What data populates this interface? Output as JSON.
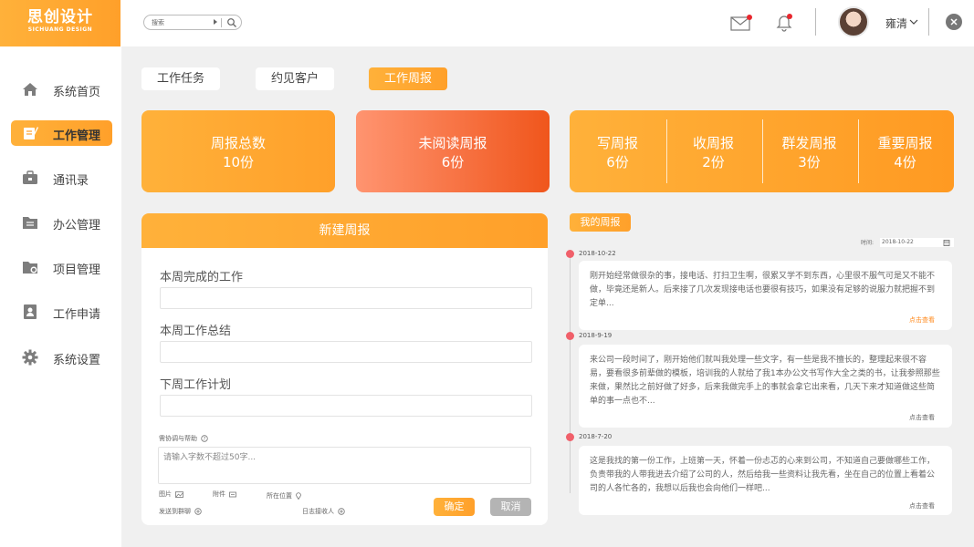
{
  "brand": {
    "name": "思创设计",
    "sub": "SICHUANG DESIGN",
    "accent": "#ffa02a",
    "alert": "#f0606a"
  },
  "search": {
    "placeholder": "搜索"
  },
  "user": {
    "name": "雍清"
  },
  "sidebar": {
    "items": [
      {
        "label": "系统首页",
        "icon": "home-icon",
        "active": false
      },
      {
        "label": "工作管理",
        "icon": "edit-note-icon",
        "active": true
      },
      {
        "label": "通讯录",
        "icon": "briefcase-icon",
        "active": false
      },
      {
        "label": "办公管理",
        "icon": "folder-doc-icon",
        "active": false
      },
      {
        "label": "项目管理",
        "icon": "folder-gear-icon",
        "active": false
      },
      {
        "label": "工作申请",
        "icon": "id-card-icon",
        "active": false
      },
      {
        "label": "系统设置",
        "icon": "gear-icon",
        "active": false
      }
    ]
  },
  "tabs": [
    {
      "label": "工作任务",
      "active": false
    },
    {
      "label": "约见客户",
      "active": false
    },
    {
      "label": "工作周报",
      "active": true
    }
  ],
  "stats": {
    "total": {
      "title": "周报总数",
      "value": "10份"
    },
    "unread": {
      "title": "未阅读周报",
      "value": "6份"
    },
    "group": [
      {
        "title": "写周报",
        "value": "6份"
      },
      {
        "title": "收周报",
        "value": "2份"
      },
      {
        "title": "群发周报",
        "value": "3份"
      },
      {
        "title": "重要周报",
        "value": "4份"
      }
    ]
  },
  "form": {
    "title": "新建周报",
    "fields": [
      {
        "label": "本周完成的工作",
        "value": ""
      },
      {
        "label": "本周工作总结",
        "value": ""
      },
      {
        "label": "下周工作计划",
        "value": ""
      }
    ],
    "help_label": "需协调与帮助",
    "help_placeholder": "请输入字数不超过50字...",
    "attach": {
      "image": "图片",
      "file": "附件",
      "location": "所在位置",
      "send_group": "发送到群聊",
      "receivers": "日志接收人"
    },
    "ok_label": "确定",
    "cancel_label": "取消"
  },
  "reports": {
    "title": "我的周报",
    "time_label": "时间:",
    "time_value": "2018-10-22",
    "items": [
      {
        "date": "2018-10-22",
        "text": "刚开始经常做很杂的事，接电话、打扫卫生啊，很累又学不到东西，心里很不服气可是又不能不做，毕竟还是新人。后来接了几次发现接电话也要很有技巧，如果没有足够的说服力就把握不到定单...",
        "link": "点击查看",
        "link_color": "#ff8a1e"
      },
      {
        "date": "2018-9-19",
        "text": "来公司一段时间了，刚开始他们就叫我处理一些文字，有一些是我不擅长的，整理起来很不容易，要看很多前辈做的模板，培训我的人就给了我1本办公文书写作大全之类的书，让我参照那些来做，果然比之前好做了好多，后来我做完手上的事就会拿它出来看，几天下来才知道做这些简单的事一点也不...",
        "link": "点击查看",
        "link_color": "#666666"
      },
      {
        "date": "2018-7-20",
        "text": "这是我找的第一份工作，上班第一天，怀着一份忐忑的心来到公司，不知道自己要做哪些工作，负责带我的人带我进去介绍了公司的人，然后给我一些资料让我先看，坐在自己的位置上看着公司的人各忙各的，我想以后我也会向他们一样吧...",
        "link": "点击查看",
        "link_color": "#666666"
      }
    ]
  }
}
